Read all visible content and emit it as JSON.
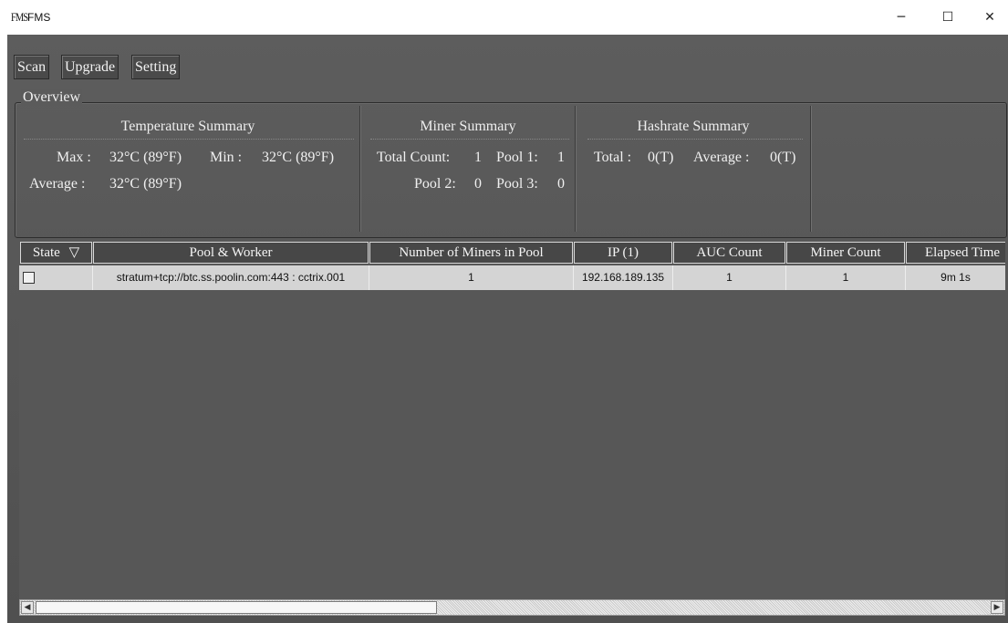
{
  "window": {
    "logo_text": "FMS",
    "title": "FMS",
    "minimize_glyph": "─",
    "maximize_glyph": "☐",
    "close_glyph": "✕"
  },
  "toolbar": {
    "scan_label": "Scan",
    "upgrade_label": "Upgrade",
    "setting_label": "Setting"
  },
  "overview": {
    "label": "Overview",
    "temperature": {
      "title": "Temperature Summary",
      "max_label": "Max :",
      "max_value": "32°C (89°F)",
      "min_label": "Min :",
      "min_value": "32°C (89°F)",
      "avg_label": "Average :",
      "avg_value": "32°C (89°F)"
    },
    "miner": {
      "title": "Miner Summary",
      "total_label": "Total Count:",
      "total_value": "1",
      "pool1_label": "Pool 1:",
      "pool1_value": "1",
      "pool2_label": "Pool 2:",
      "pool2_value": "0",
      "pool3_label": "Pool 3:",
      "pool3_value": "0"
    },
    "hashrate": {
      "title": "Hashrate Summary",
      "total_label": "Total :",
      "total_value": "0(T)",
      "avg_label": "Average :",
      "avg_value": "0(T)"
    }
  },
  "table": {
    "columns": [
      "State",
      "Pool & Worker",
      "Number of Miners in Pool",
      "IP (1)",
      "AUC Count",
      "Miner Count",
      "Elapsed Time"
    ],
    "state_filter_glyph": "▽",
    "rows": [
      {
        "pool_worker": "stratum+tcp://btc.ss.poolin.com:443 : cctrix.001",
        "num_miners": "1",
        "ip": "192.168.189.135",
        "auc_count": "1",
        "miner_count": "1",
        "elapsed": "9m 1s"
      }
    ]
  },
  "scrollbar": {
    "left_arrow": "◀",
    "right_arrow": "▶"
  }
}
